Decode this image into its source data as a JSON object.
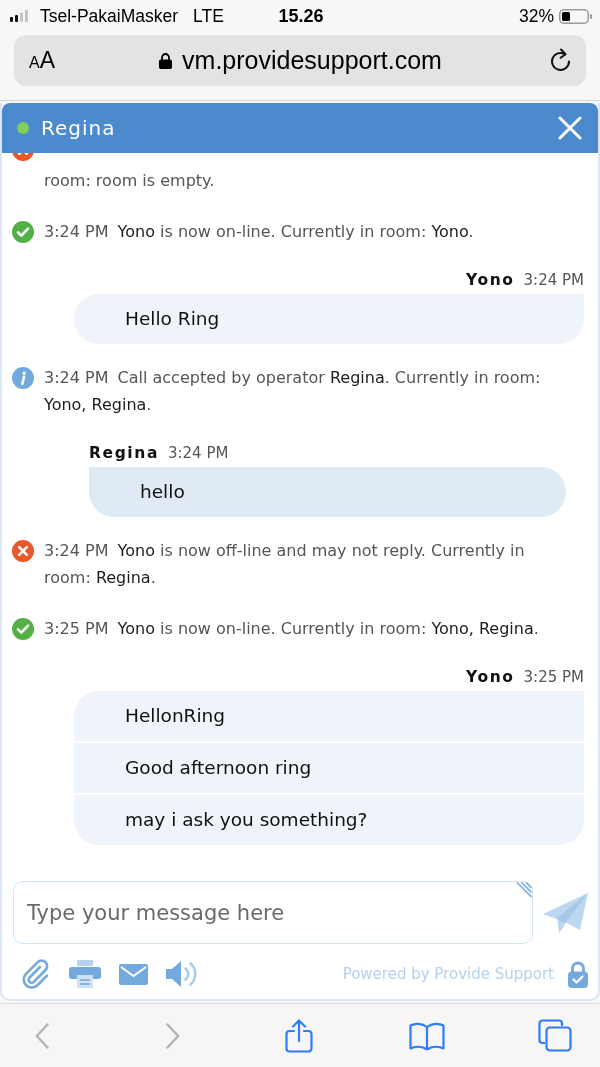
{
  "status_bar": {
    "carrier": "Tsel-PakaiMasker",
    "network": "LTE",
    "time": "15.26",
    "battery": "32%"
  },
  "address_bar": {
    "text_size": "AA",
    "url": "vm.providesupport.com",
    "secure": true
  },
  "chat": {
    "header": {
      "title": "Regina",
      "online": true
    },
    "messages": [
      {
        "kind": "offline",
        "cut_off": true,
        "text": "room: room is empty."
      },
      {
        "kind": "online",
        "time": "3:24 PM",
        "text": "**Yono** is now on-line. Currently in room: **Yono**."
      },
      {
        "kind": "visitor",
        "author": "Yono",
        "time": "3:24 PM",
        "lines": [
          "Hello Ring"
        ]
      },
      {
        "kind": "info",
        "time": "3:24 PM",
        "text": "Call accepted by operator **Regina**. Currently in room: **Yono, Regina**."
      },
      {
        "kind": "operator",
        "author": "Regina",
        "time": "3:24 PM",
        "lines": [
          "hello"
        ]
      },
      {
        "kind": "offline",
        "time": "3:24 PM",
        "text": "**Yono** is now off-line and may not reply. Currently in room: **Regina**."
      },
      {
        "kind": "online",
        "time": "3:25 PM",
        "text": "**Yono** is now on-line. Currently in room: **Yono, Regina**."
      },
      {
        "kind": "visitor",
        "author": "Yono",
        "time": "3:25 PM",
        "lines": [
          "HellonRing",
          "Good afternoon ring",
          "may i ask you something?"
        ]
      }
    ],
    "composer": {
      "placeholder": "Type your message here"
    },
    "powered_by": "Powered by Provide Support"
  },
  "browser_toolbar": {
    "back": {
      "disabled": true
    },
    "forward": {
      "disabled": true
    }
  }
}
